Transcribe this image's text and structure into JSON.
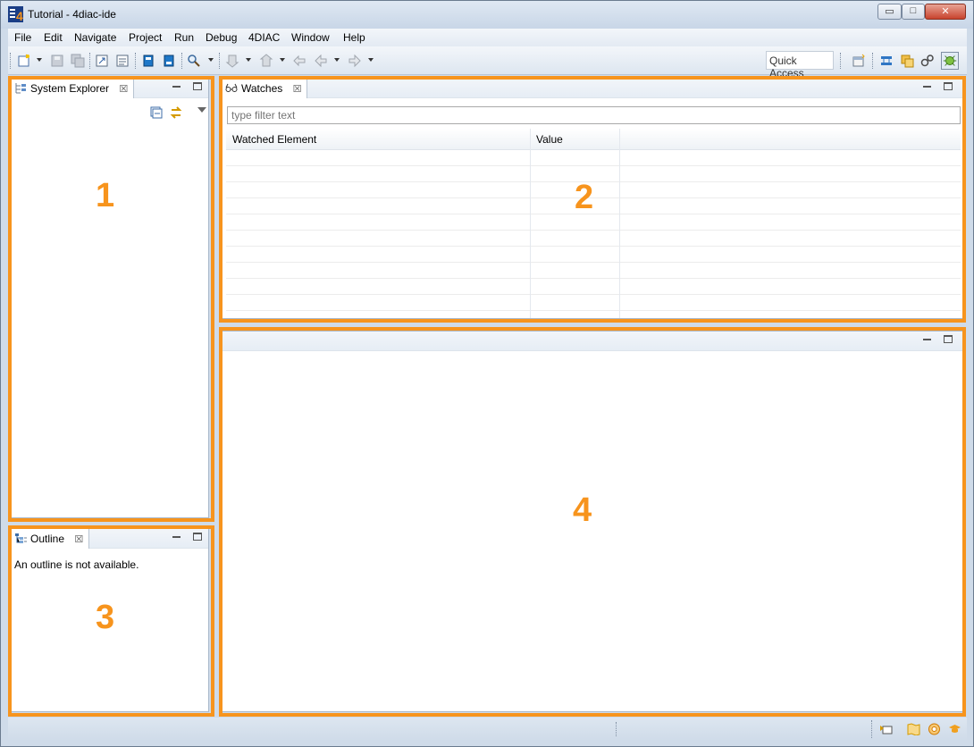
{
  "window": {
    "title": "Tutorial - 4diac-ide",
    "min_glyph": "▭",
    "max_glyph": "□",
    "close_glyph": "✕"
  },
  "menu": [
    "File",
    "Edit",
    "Navigate",
    "Project",
    "Run",
    "Debug",
    "4DIAC",
    "Window",
    "Help"
  ],
  "toolbar": {
    "quick_access_label": "Quick Access",
    "icons": [
      "new-wizard-icon",
      "save-icon",
      "save-all-icon",
      "export-icon",
      "import-icon",
      "deploy-icon",
      "stop-deploy-icon",
      "search-icon",
      "next-annotation-icon",
      "prev-annotation-icon",
      "last-edit-icon",
      "back-icon",
      "forward-icon",
      "open-perspective-icon",
      "system-perspective-icon",
      "type-perspective-icon",
      "deployment-perspective-icon",
      "debug-perspective-icon"
    ]
  },
  "system_explorer": {
    "tab_label": "System Explorer",
    "close_glyph": "☒",
    "region_number": "1"
  },
  "watches": {
    "tab_label": "Watches",
    "close_glyph": "☒",
    "filter_placeholder": "type filter text",
    "columns": [
      "Watched Element",
      "Value"
    ],
    "rows": [
      "",
      "",
      "",
      "",
      "",
      "",
      "",
      "",
      "",
      ""
    ],
    "region_number": "2"
  },
  "outline": {
    "tab_label": "Outline",
    "close_glyph": "☒",
    "message": "An outline is not available.",
    "region_number": "3"
  },
  "editor_area": {
    "region_number": "4"
  },
  "colors": {
    "highlight": "#f7941d",
    "chrome": "#cfdbe9"
  }
}
